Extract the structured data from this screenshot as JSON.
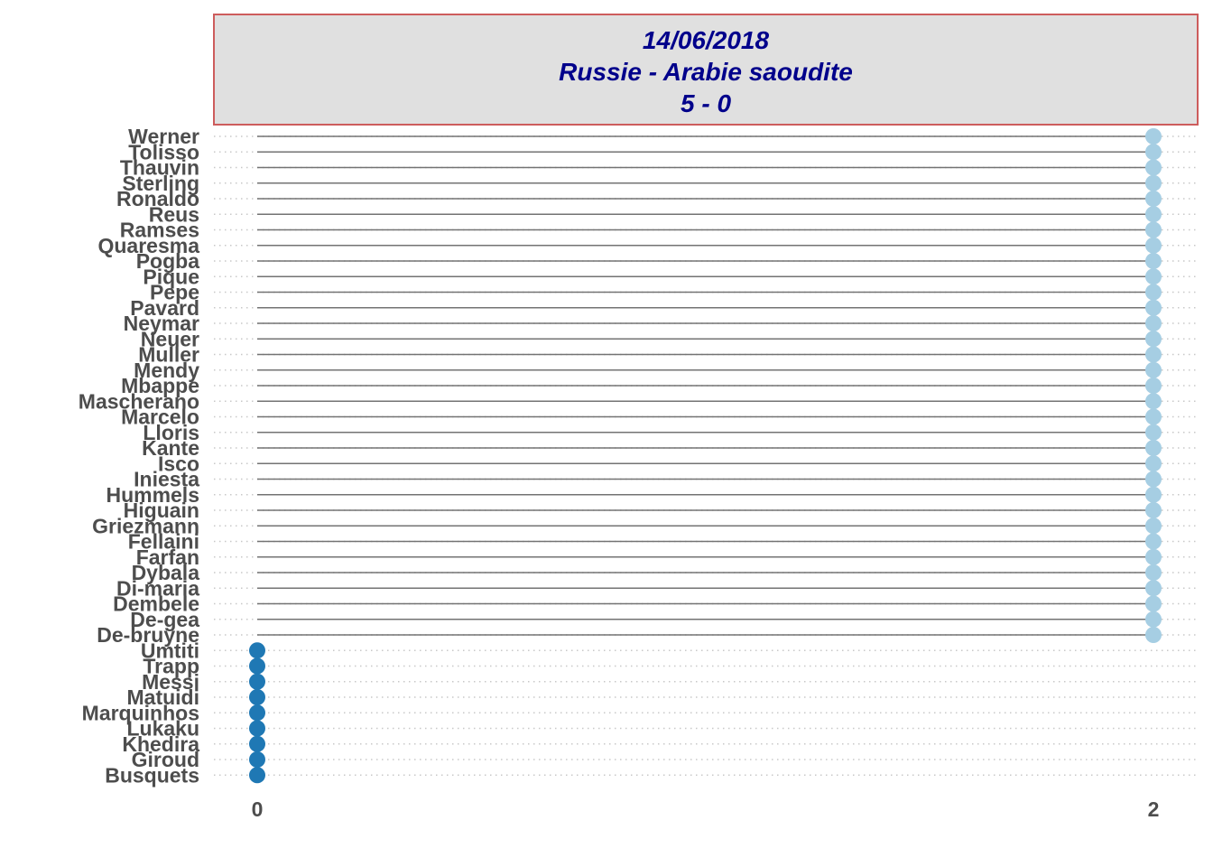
{
  "chart_data": {
    "type": "lollipop",
    "title_lines": [
      "14/06/2018",
      "Russie - Arabie saoudite",
      "5 - 0"
    ],
    "categories": [
      "Werner",
      "Tolisso",
      "Thauvin",
      "Sterling",
      "Ronaldo",
      "Reus",
      "Ramses",
      "Quaresma",
      "Pogba",
      "Pique",
      "Pepe",
      "Pavard",
      "Neymar",
      "Neuer",
      "Muller",
      "Mendy",
      "Mbappe",
      "Mascherano",
      "Marcelo",
      "Lloris",
      "Kante",
      "Isco",
      "Iniesta",
      "Hummels",
      "Higuain",
      "Griezmann",
      "Fellaini",
      "Farfan",
      "Dybala",
      "Di-maria",
      "Dembele",
      "De-gea",
      "De-bruyne",
      "Umtiti",
      "Trapp",
      "Messi",
      "Matuidi",
      "Marquinhos",
      "Lukaku",
      "Khedira",
      "Giroud",
      "Busquets"
    ],
    "values": [
      2,
      2,
      2,
      2,
      2,
      2,
      2,
      2,
      2,
      2,
      2,
      2,
      2,
      2,
      2,
      2,
      2,
      2,
      2,
      2,
      2,
      2,
      2,
      2,
      2,
      2,
      2,
      2,
      2,
      2,
      2,
      2,
      2,
      0,
      0,
      0,
      0,
      0,
      0,
      0,
      0,
      0
    ],
    "x_ticks": [
      "0",
      "2"
    ],
    "xlim": [
      0,
      2
    ],
    "grid": "dotted horizontal",
    "colors": {
      "high": "#a6cee3",
      "low": "#1f78b4",
      "segment": "#737373",
      "title_text": "#00008b",
      "title_fill": "#e0e0e0",
      "title_border": "#cd5c5c",
      "axis_text": "#4d4d4d",
      "grid": "#c8c8c8"
    }
  }
}
